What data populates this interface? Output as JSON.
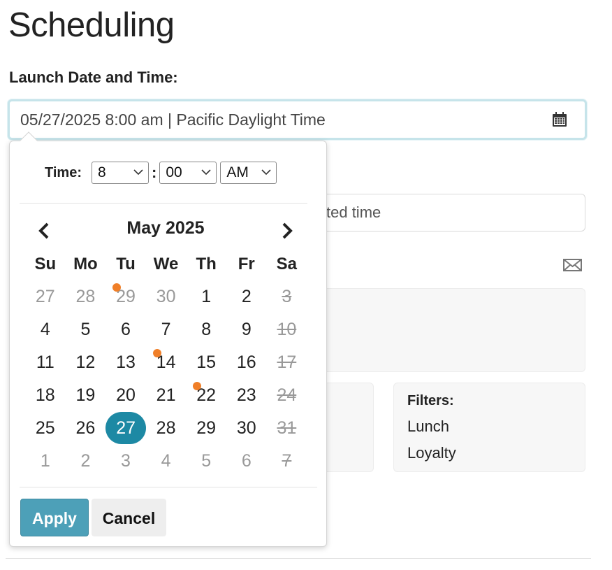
{
  "page": {
    "title": "Scheduling"
  },
  "launch": {
    "label": "Launch Date and Time:",
    "value": "05/27/2025 8:00 am | Pacific Daylight Time",
    "icon": "calendar-icon"
  },
  "background": {
    "partial_field_text": "ted time",
    "mail_icon": "envelope-icon",
    "filters": {
      "title": "Filters:",
      "items": [
        "Lunch",
        "Loyalty"
      ]
    }
  },
  "picker": {
    "time_label": "Time:",
    "hour": "8",
    "colon": ":",
    "minute": "00",
    "ampm": "AM",
    "month_title": "May 2025",
    "weekdays": [
      "Su",
      "Mo",
      "Tu",
      "We",
      "Th",
      "Fr",
      "Sa"
    ],
    "weeks": [
      [
        {
          "d": "27",
          "muted": true
        },
        {
          "d": "28",
          "muted": true
        },
        {
          "d": "29",
          "muted": true,
          "dot": true
        },
        {
          "d": "30",
          "muted": true
        },
        {
          "d": "1"
        },
        {
          "d": "2"
        },
        {
          "d": "3",
          "struck": true
        }
      ],
      [
        {
          "d": "4"
        },
        {
          "d": "5"
        },
        {
          "d": "6"
        },
        {
          "d": "7"
        },
        {
          "d": "8"
        },
        {
          "d": "9"
        },
        {
          "d": "10",
          "struck": true
        }
      ],
      [
        {
          "d": "11"
        },
        {
          "d": "12"
        },
        {
          "d": "13"
        },
        {
          "d": "14",
          "dot": true
        },
        {
          "d": "15"
        },
        {
          "d": "16"
        },
        {
          "d": "17",
          "struck": true
        }
      ],
      [
        {
          "d": "18"
        },
        {
          "d": "19"
        },
        {
          "d": "20"
        },
        {
          "d": "21"
        },
        {
          "d": "22",
          "dot": true
        },
        {
          "d": "23"
        },
        {
          "d": "24",
          "struck": true
        }
      ],
      [
        {
          "d": "25"
        },
        {
          "d": "26"
        },
        {
          "d": "27",
          "selected": true
        },
        {
          "d": "28"
        },
        {
          "d": "29"
        },
        {
          "d": "30"
        },
        {
          "d": "31",
          "struck": true
        }
      ],
      [
        {
          "d": "1",
          "muted": true
        },
        {
          "d": "2",
          "muted": true
        },
        {
          "d": "3",
          "muted": true
        },
        {
          "d": "4",
          "muted": true
        },
        {
          "d": "5",
          "muted": true
        },
        {
          "d": "6",
          "muted": true
        },
        {
          "d": "7",
          "struck": true
        }
      ]
    ],
    "apply_label": "Apply",
    "cancel_label": "Cancel"
  },
  "colors": {
    "accent": "#1d89a4",
    "apply_bg": "#4da0b8",
    "event_dot": "#f07f28"
  }
}
